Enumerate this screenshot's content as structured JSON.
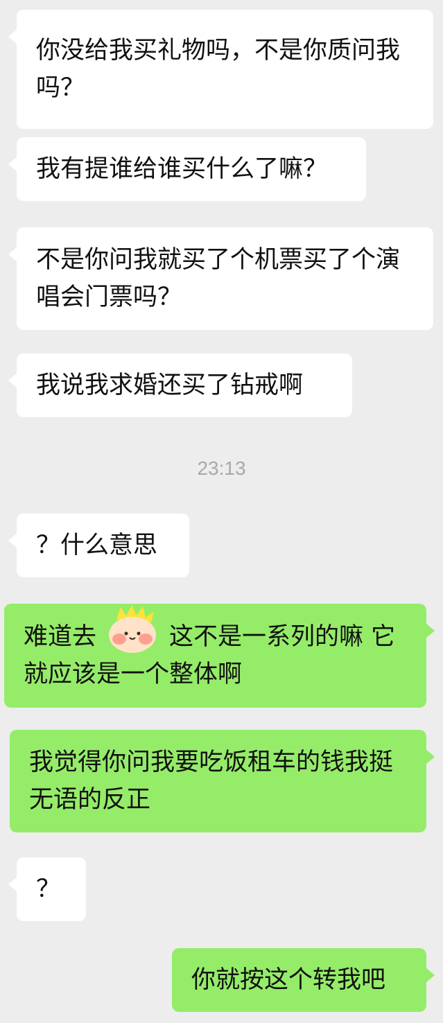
{
  "chat": {
    "messages": [
      {
        "side": "in",
        "text": "你没给我买礼物吗，不是你质问我吗？"
      },
      {
        "side": "in",
        "text": "我有提谁给谁买什么了嘛？"
      },
      {
        "side": "in",
        "text": "不是你问我就买了个机票买了个演唱会门票吗？"
      },
      {
        "side": "in",
        "text": "我说我求婚还买了钻戒啊"
      },
      {
        "side": "in",
        "text": "？什么意思"
      },
      {
        "side": "out",
        "text": "难道去　　　这不是一系列的嘛 它就应该是一个整体啊"
      },
      {
        "side": "out",
        "text": "我觉得你问我要吃饭租车的钱我挺无语的反正"
      },
      {
        "side": "in",
        "text": "？"
      },
      {
        "side": "out",
        "text": "你就按这个转我吧"
      }
    ],
    "timestamp": "23:13"
  },
  "colors": {
    "background": "#ededed",
    "incoming_bubble": "#ffffff",
    "outgoing_bubble": "#95ec69",
    "timestamp_text": "#a8a8a8"
  },
  "icons": {
    "sticker": "blushing-face-sticker"
  }
}
